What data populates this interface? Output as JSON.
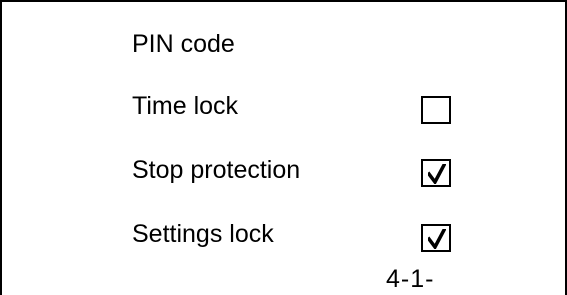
{
  "menu": {
    "items": [
      {
        "label": "PIN code",
        "has_checkbox": false
      },
      {
        "label": "Time lock",
        "has_checkbox": true,
        "checked": false
      },
      {
        "label": "Stop protection",
        "has_checkbox": true,
        "checked": true
      },
      {
        "label": "Settings lock",
        "has_checkbox": true,
        "checked": true
      }
    ]
  },
  "page_indicator": "4-1-",
  "colors": {
    "background": "#ffffff",
    "foreground": "#000000"
  },
  "icons": {
    "check": "check-icon"
  }
}
